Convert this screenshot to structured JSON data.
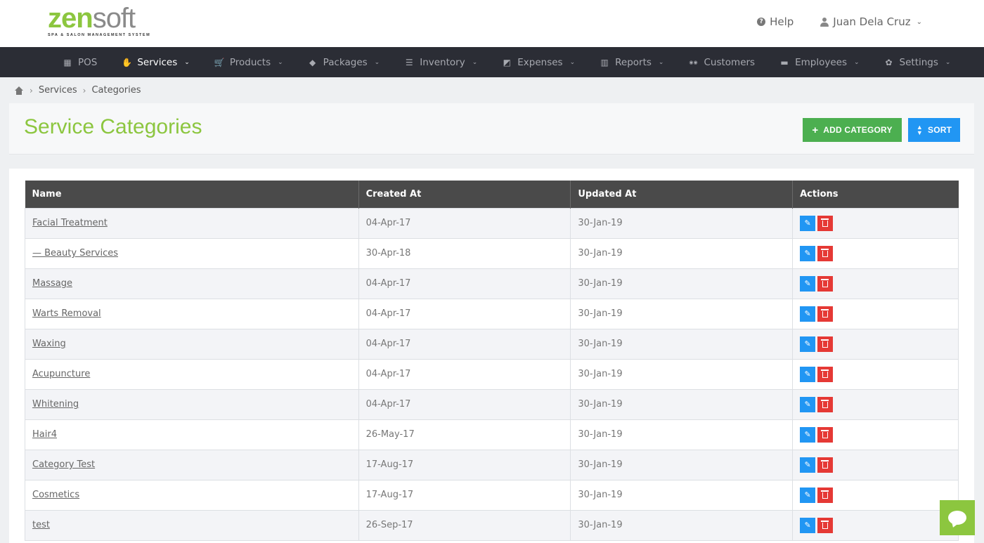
{
  "brand": {
    "logo_zen": "zen",
    "logo_soft": "soft",
    "tagline": "SPA & SALON MANAGEMENT SYSTEM",
    "accent": "#8cc63f"
  },
  "top": {
    "help": "Help",
    "user": "Juan Dela Cruz"
  },
  "nav": {
    "items": [
      {
        "label": "POS",
        "icon": "calculator-icon",
        "dropdown": false,
        "active": false
      },
      {
        "label": "Services",
        "icon": "hand-icon",
        "dropdown": true,
        "active": true
      },
      {
        "label": "Products",
        "icon": "cart-icon",
        "dropdown": true,
        "active": false
      },
      {
        "label": "Packages",
        "icon": "tags-icon",
        "dropdown": true,
        "active": false
      },
      {
        "label": "Inventory",
        "icon": "list-icon",
        "dropdown": true,
        "active": false
      },
      {
        "label": "Expenses",
        "icon": "edit-icon",
        "dropdown": true,
        "active": false
      },
      {
        "label": "Reports",
        "icon": "bar-chart-icon",
        "dropdown": true,
        "active": false
      },
      {
        "label": "Customers",
        "icon": "users-icon",
        "dropdown": false,
        "active": false
      },
      {
        "label": "Employees",
        "icon": "briefcase-icon",
        "dropdown": true,
        "active": false
      },
      {
        "label": "Settings",
        "icon": "gear-icon",
        "dropdown": true,
        "active": false
      }
    ]
  },
  "breadcrumb": {
    "items": [
      "Services",
      "Categories"
    ]
  },
  "page": {
    "title": "Service Categories",
    "add_label": "ADD CATEGORY",
    "sort_label": "SORT"
  },
  "table": {
    "headers": [
      "Name",
      "Created At",
      "Updated At",
      "Actions"
    ],
    "rows": [
      {
        "name": "Facial Treatment",
        "created": "04-Apr-17",
        "updated": "30-Jan-19"
      },
      {
        "name": "— Beauty Services",
        "created": "30-Apr-18",
        "updated": "30-Jan-19"
      },
      {
        "name": "Massage",
        "created": "04-Apr-17",
        "updated": "30-Jan-19"
      },
      {
        "name": "Warts Removal",
        "created": "04-Apr-17",
        "updated": "30-Jan-19"
      },
      {
        "name": "Waxing",
        "created": "04-Apr-17",
        "updated": "30-Jan-19"
      },
      {
        "name": "Acupuncture",
        "created": "04-Apr-17",
        "updated": "30-Jan-19"
      },
      {
        "name": "Whitening",
        "created": "04-Apr-17",
        "updated": "30-Jan-19"
      },
      {
        "name": "Hair4",
        "created": "26-May-17",
        "updated": "30-Jan-19"
      },
      {
        "name": "Category Test",
        "created": "17-Aug-17",
        "updated": "30-Jan-19"
      },
      {
        "name": "Cosmetics",
        "created": "17-Aug-17",
        "updated": "30-Jan-19"
      },
      {
        "name": "test",
        "created": "26-Sep-17",
        "updated": "30-Jan-19"
      }
    ]
  }
}
